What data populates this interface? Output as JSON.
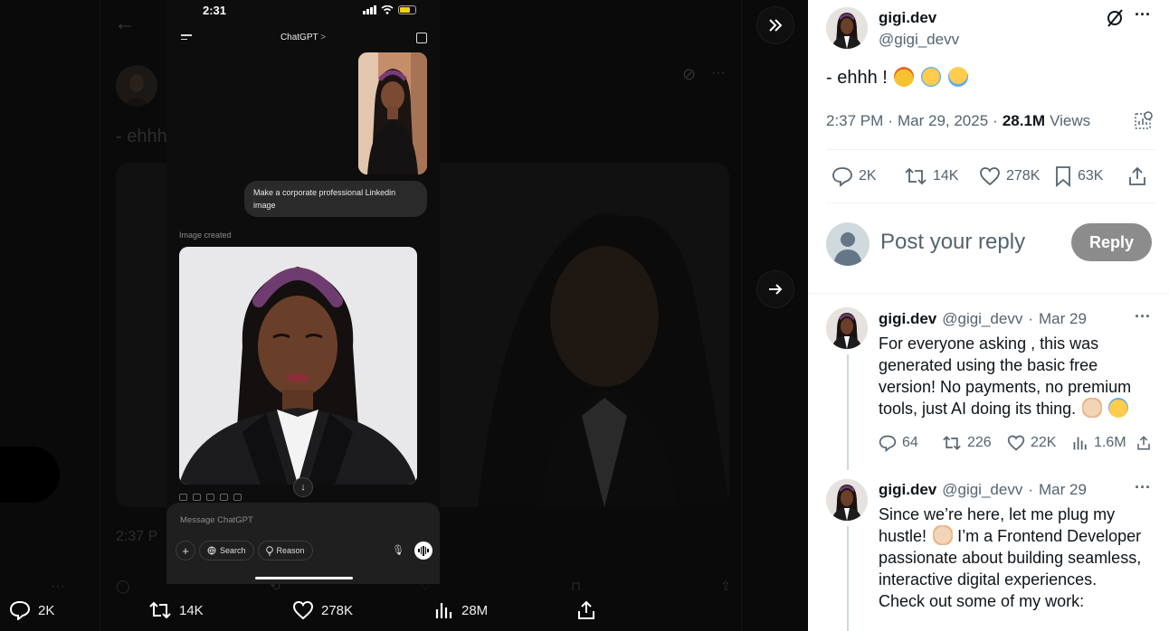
{
  "background": {
    "text_snippet": "- ehhh",
    "timestamp_snippet": "2:37 P"
  },
  "phone": {
    "status_time": "2:31",
    "header_title": "ChatGPT",
    "header_chevron": ">",
    "user_prompt": "Make a corporate professional Linkedin image",
    "image_created_label": "Image created",
    "composer_placeholder": "Message ChatGPT",
    "search_label": "Search",
    "reason_label": "Reason",
    "plus_label": "+"
  },
  "bottom_bar": {
    "replies": "2K",
    "reposts": "14K",
    "likes": "278K",
    "views": "28M"
  },
  "tweet": {
    "display_name": "gigi.dev",
    "handle": "@gigi_devv",
    "text": "- ehhh !",
    "emojis": [
      "exploding-head-emoji",
      "tears-of-joy-emoji",
      "crying-emoji"
    ],
    "time": "2:37 PM",
    "sep": "·",
    "date": "Mar 29, 2025",
    "views_count": "28.1M",
    "views_label": "Views",
    "replies": "2K",
    "reposts": "14K",
    "likes": "278K",
    "bookmarks": "63K"
  },
  "reply_box": {
    "placeholder": "Post your reply",
    "button": "Reply"
  },
  "replies": [
    {
      "display_name": "gigi.dev",
      "handle": "@gigi_devv",
      "date": "Mar 29",
      "text": "For everyone asking , this was generated using the basic free version! No payments, no premium tools, just AI doing its thing.",
      "emojis": [
        "waving-hand-emoji",
        "grinning-sweat-emoji"
      ],
      "replies": "64",
      "reposts": "226",
      "likes": "22K",
      "views": "1.6M"
    },
    {
      "display_name": "gigi.dev",
      "handle": "@gigi_devv",
      "date": "Mar 29",
      "text_lines": [
        "Since we’re here, let me plug my",
        "hustle!",
        "I’m a Frontend Developer",
        "passionate about building seamless,",
        "interactive digital experiences.",
        "Check out some of my work:"
      ],
      "emojis": [
        "waving-hand-emoji"
      ]
    }
  ],
  "colors": {
    "text_primary": "#0f1419",
    "text_secondary": "#536471",
    "reply_button": "#8c8c8c",
    "divider": "#eff3f4"
  }
}
